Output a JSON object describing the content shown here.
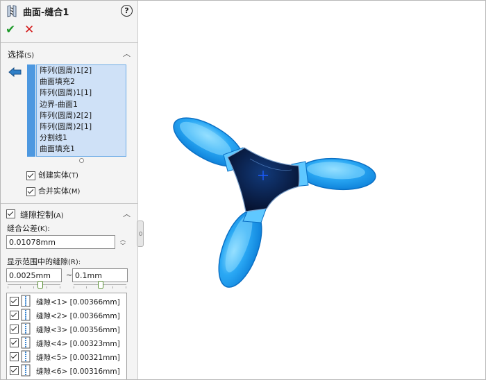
{
  "title": "曲面-缝合1",
  "help_glyph": "?",
  "ok_glyph": "✔",
  "cancel_glyph": "✕",
  "collapse_glyph": "︿",
  "selection": {
    "header": "选择",
    "accel": "(S)",
    "items": [
      "阵列(圆周)1[2]",
      "曲面填充2",
      "阵列(圆周)1[1]",
      "边界-曲面1",
      "阵列(圆周)2[2]",
      "阵列(圆周)2[1]",
      "分割线1",
      "曲面填充1"
    ],
    "create_solid_label": "创建实体",
    "create_solid_accel": "(T)",
    "create_solid_checked": true,
    "merge_entities_label": "合并实体",
    "merge_entities_accel": "(M)",
    "merge_entities_checked": true
  },
  "gap_control": {
    "header": "缝隙控制",
    "accel": "(A)",
    "enabled": true,
    "tolerance_label": "缝合公差",
    "tolerance_accel": "(K):",
    "tolerance_value": "0.01078mm",
    "range_label": "显示范围中的缝隙",
    "range_accel": "(R):",
    "range_min": "0.0025mm",
    "range_max": "0.1mm",
    "range_separator": "~",
    "gaps": [
      {
        "label": "缝隙<1>",
        "value": "[0.00366mm]",
        "checked": true
      },
      {
        "label": "缝隙<2>",
        "value": "[0.00366mm]",
        "checked": true
      },
      {
        "label": "缝隙<3>",
        "value": "[0.00356mm]",
        "checked": true
      },
      {
        "label": "缝隙<4>",
        "value": "[0.00323mm]",
        "checked": true
      },
      {
        "label": "缝隙<5>",
        "value": "[0.00321mm]",
        "checked": true
      },
      {
        "label": "缝隙<6>",
        "value": "[0.00316mm]",
        "checked": true
      }
    ]
  },
  "colors": {
    "accent_blue": "#4d98e0",
    "selection_bg": "#cfe1f7",
    "model_blue": "#2aa8f4",
    "model_hub": "#0a1f4a",
    "ok_green": "#1e9a2a",
    "cancel_red": "#d41a1a"
  },
  "icons": {
    "title": "surface-knit-icon",
    "selection": "surface-selection-icon",
    "gap": "gap-icon"
  }
}
